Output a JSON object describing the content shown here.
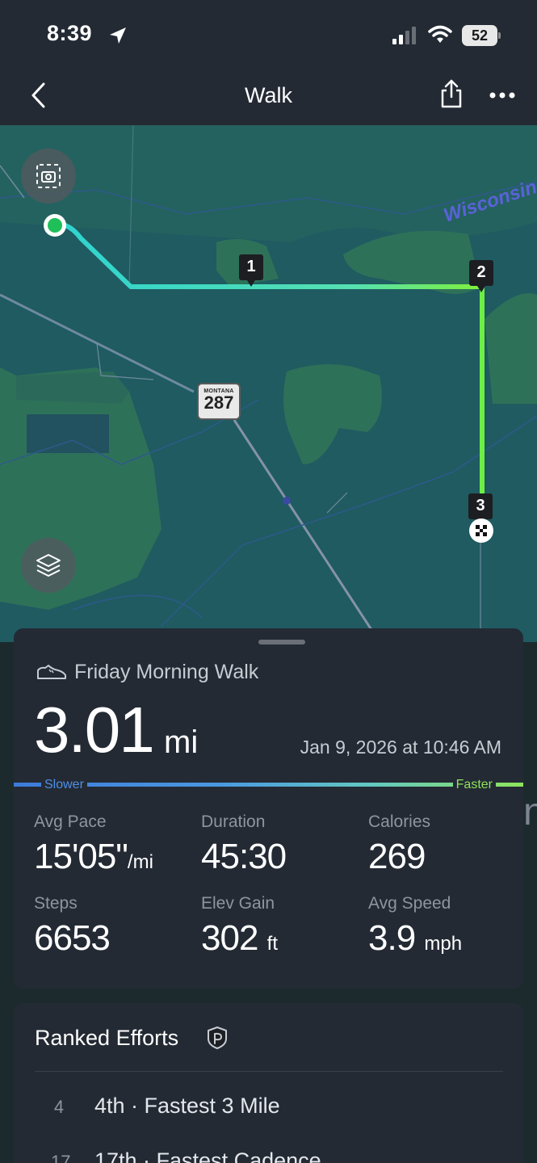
{
  "status_bar": {
    "time": "8:39",
    "battery": "52"
  },
  "header": {
    "title": "Walk",
    "back_icon": "chevron-left-icon",
    "share_icon": "share-icon",
    "more_icon": "ellipsis-icon"
  },
  "map": {
    "screenshot_icon": "screenshot-icon",
    "layers_icon": "layers-icon",
    "place_label": "Wisconsin",
    "highway": {
      "state": "MONTANA",
      "number": "287"
    },
    "markers": [
      "1",
      "2",
      "3"
    ],
    "colors": {
      "route_start": "#2fd3d0",
      "route_end": "#7ef03b",
      "start_marker": "#1fbf5a",
      "land": "#2a6d5c",
      "water": "#1f5b61"
    }
  },
  "activity": {
    "icon": "shoe-icon",
    "name": "Friday Morning Walk",
    "distance": "3.01",
    "distance_unit": "mi",
    "date": "Jan 9, 2026 at 10:46 AM",
    "pace_legend": {
      "slower": "Slower",
      "faster": "Faster"
    },
    "stats": [
      {
        "label": "Avg Pace",
        "value": "15'05\"",
        "unit": "/mi"
      },
      {
        "label": "Duration",
        "value": "45:30",
        "unit": ""
      },
      {
        "label": "Calories",
        "value": "269",
        "unit": ""
      },
      {
        "label": "Steps",
        "value": "6653",
        "unit": ""
      },
      {
        "label": "Elev Gain",
        "value": "302",
        "unit": "ft"
      },
      {
        "label": "Avg Speed",
        "value": "3.9",
        "unit": "mph"
      }
    ]
  },
  "ranked_efforts": {
    "title": "Ranked Efforts",
    "badge_icon": "pr-badge-icon",
    "items": [
      {
        "rank": "4",
        "text": "4th · Fastest 3 Mile"
      },
      {
        "rank": "17",
        "text": "17th · Fastest Cadence"
      }
    ]
  },
  "edge_text": "n"
}
